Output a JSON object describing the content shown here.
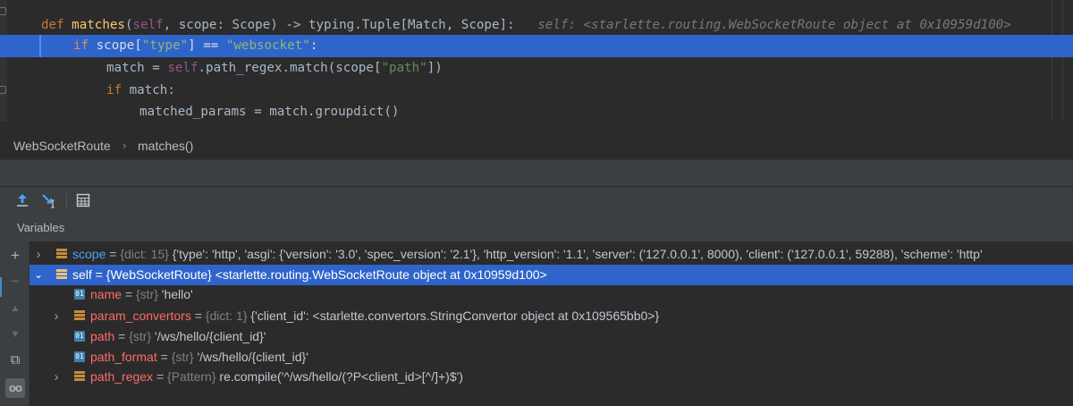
{
  "editor": {
    "lines": [
      {
        "indent": "",
        "tokens": [
          {
            "t": "def ",
            "c": "kw"
          },
          {
            "t": "matches",
            "c": "fn"
          },
          {
            "t": "(",
            "c": "plain"
          },
          {
            "t": "self",
            "c": "slf"
          },
          {
            "t": ", scope: Scope) -> typing.Tuple[Match, Scope]:",
            "c": "plain"
          },
          {
            "t": "   self: <starlette.routing.WebSocketRoute object at 0x10959d100>",
            "c": "inline-dbg"
          }
        ]
      },
      {
        "indent": "",
        "highlighted": true,
        "tokens": [
          {
            "t": "if ",
            "c": "kw"
          },
          {
            "t": "scope[",
            "c": "plain"
          },
          {
            "t": "\"type\"",
            "c": "str"
          },
          {
            "t": "] == ",
            "c": "plain"
          },
          {
            "t": "\"websocket\"",
            "c": "str"
          },
          {
            "t": ":",
            "c": "plain"
          }
        ]
      },
      {
        "indent": "",
        "tokens": [
          {
            "t": "match = ",
            "c": "plain"
          },
          {
            "t": "self",
            "c": "slf"
          },
          {
            "t": ".path_regex.match(scope[",
            "c": "plain"
          },
          {
            "t": "\"path\"",
            "c": "str"
          },
          {
            "t": "])",
            "c": "plain"
          }
        ]
      },
      {
        "indent": "",
        "tokens": [
          {
            "t": "if ",
            "c": "kw"
          },
          {
            "t": "match:",
            "c": "plain"
          }
        ]
      },
      {
        "indent": "",
        "tokens": [
          {
            "t": "matched_params = match.groupdict()",
            "c": "plain"
          }
        ]
      }
    ]
  },
  "breadcrumb": {
    "items": [
      "WebSocketRoute",
      "matches()"
    ],
    "separator": "›"
  },
  "debug": {
    "toolbar": {
      "step_out_icon": "step-out-icon",
      "run_to_cursor_icon": "run-to-cursor-icon",
      "evaluate_icon": "evaluate-expression-icon"
    },
    "variables_title": "Variables",
    "side_buttons": [
      "+",
      "−",
      "▲",
      "▼",
      "⧉",
      "oo"
    ],
    "variables": [
      {
        "expandable": true,
        "expanded": false,
        "icon": "field",
        "name": "scope",
        "name_color": "blue",
        "eq": " = ",
        "type": "{dict: 15}",
        "value": " {'type': 'http', 'asgi': {'version': '3.0', 'spec_version': '2.1'}, 'http_version': '1.1', 'server': ('127.0.0.1', 8000), 'client': ('127.0.0.1', 59288), 'scheme': 'http'"
      },
      {
        "expandable": true,
        "expanded": true,
        "selected": true,
        "icon": "field",
        "name": "self",
        "eq": " = ",
        "type": "{WebSocketRoute}",
        "value": " <starlette.routing.WebSocketRoute object at 0x10959d100>"
      },
      {
        "child": true,
        "icon": "prim",
        "name": "name",
        "eq": " = ",
        "type": "{str}",
        "value": " 'hello'"
      },
      {
        "child": true,
        "expandable": true,
        "expanded": false,
        "icon": "field",
        "name": "param_convertors",
        "eq": " = ",
        "type": "{dict: 1}",
        "value": " {'client_id': <starlette.convertors.StringConvertor object at 0x109565bb0>}"
      },
      {
        "child": true,
        "icon": "prim",
        "name": "path",
        "eq": " = ",
        "type": "{str}",
        "value": " '/ws/hello/{client_id}'"
      },
      {
        "child": true,
        "icon": "prim",
        "name": "path_format",
        "eq": " = ",
        "type": "{str}",
        "value": " '/ws/hello/{client_id}'"
      },
      {
        "child": true,
        "expandable": true,
        "expanded": false,
        "icon": "field",
        "name": "path_regex",
        "eq": " = ",
        "type": "{Pattern}",
        "value": " re.compile('^/ws/hello/(?P<client_id>[^/]+)$')"
      }
    ]
  },
  "colors": {
    "editor_bg": "#2b2b2b",
    "panel_bg": "#3c3f41",
    "selection": "#2f65ca",
    "keyword": "#cc7832",
    "function": "#ffc66d",
    "string": "#6a8759",
    "var_name": "#ff6b68"
  }
}
